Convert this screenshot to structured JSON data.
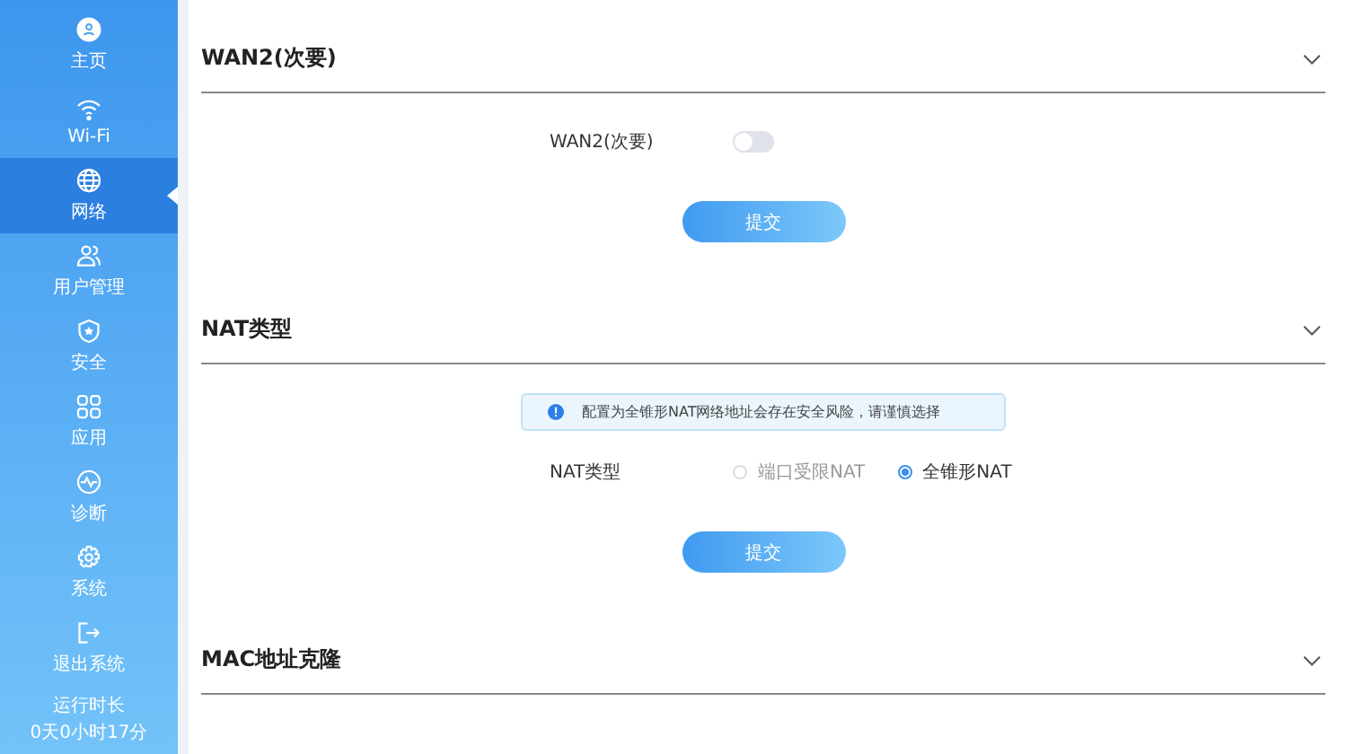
{
  "sidebar": {
    "items": [
      {
        "label": "主页",
        "kind": "home",
        "selected": false
      },
      {
        "label": "Wi-Fi",
        "kind": "wifi",
        "selected": false
      },
      {
        "label": "网络",
        "kind": "globe",
        "selected": true
      },
      {
        "label": "用户管理",
        "kind": "users",
        "selected": false
      },
      {
        "label": "安全",
        "kind": "shield",
        "selected": false
      },
      {
        "label": "应用",
        "kind": "apps",
        "selected": false
      },
      {
        "label": "诊断",
        "kind": "pulse",
        "selected": false
      },
      {
        "label": "系统",
        "kind": "gear",
        "selected": false
      },
      {
        "label": "退出系统",
        "kind": "logout",
        "selected": false
      }
    ],
    "uptime_label": "运行时长",
    "uptime": "0天0小时17分"
  },
  "sections": [
    {
      "title": "WAN2(次要)",
      "toggle": {
        "label": "WAN2(次要)",
        "on": false
      },
      "submit": "提交"
    },
    {
      "title": "NAT类型",
      "alert": "配置为全锥形NAT网络地址会存在安全风险，请谨慎选择",
      "radio_group": {
        "label": "NAT类型",
        "options": [
          {
            "label": "端口受限NAT",
            "selected": false
          },
          {
            "label": "全锥形NAT",
            "selected": true
          }
        ]
      },
      "submit": "提交"
    },
    {
      "title": "MAC地址克隆"
    }
  ]
}
